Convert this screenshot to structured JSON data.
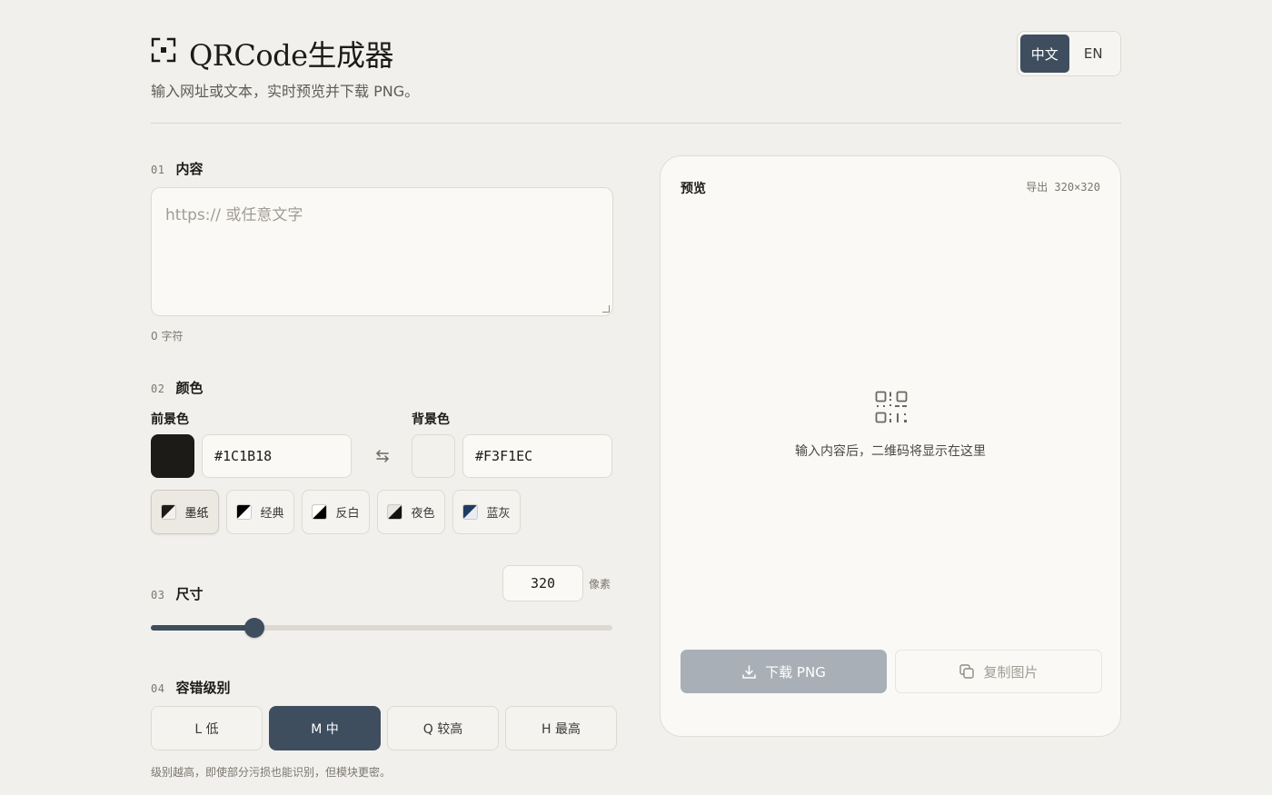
{
  "header": {
    "logo_icon": "qr-scan-icon",
    "title": "QRCode生成器",
    "subtitle": "输入网址或文本，实时预览并下载 PNG。",
    "lang_options": [
      {
        "label": "中文",
        "active": true
      },
      {
        "label": "EN",
        "active": false
      }
    ]
  },
  "content_section": {
    "num": "01",
    "name": "内容",
    "placeholder": "https:// 或任意文字",
    "value": "",
    "char_count": "0 字符"
  },
  "color_section": {
    "num": "02",
    "name": "颜色",
    "foreground_label": "前景色",
    "foreground_hex": "#1C1B18",
    "background_label": "背景色",
    "background_hex": "#F3F1EC",
    "swap_icon": "swap-arrows-icon",
    "presets": [
      {
        "label": "墨纸",
        "fg": "#1c1b18",
        "bg": "#f3f1ec",
        "active": true
      },
      {
        "label": "经典",
        "fg": "#000000",
        "bg": "#ffffff",
        "active": false
      },
      {
        "label": "反白",
        "fg": "#ffffff",
        "bg": "#000000",
        "active": false
      },
      {
        "label": "夜色",
        "fg": "#e8e6e0",
        "bg": "#121212",
        "active": false
      },
      {
        "label": "蓝灰",
        "fg": "#1f3b63",
        "bg": "#e9edf3",
        "active": false
      }
    ]
  },
  "size_section": {
    "num": "03",
    "name": "尺寸",
    "value": "320",
    "unit": "像素",
    "slider_fraction": 0.225
  },
  "ec_section": {
    "num": "04",
    "name": "容错级别",
    "options": [
      {
        "label": "L 低",
        "active": false
      },
      {
        "label": "M 中",
        "active": true
      },
      {
        "label": "Q 较高",
        "active": false
      },
      {
        "label": "H 最高",
        "active": false
      }
    ],
    "hint": "级别越高，即使部分污损也能识别，但模块更密。"
  },
  "preview": {
    "title": "预览",
    "export_info": "导出 320×320",
    "empty_icon": "qr-code-icon",
    "empty_text": "输入内容后，二维码将显示在这里",
    "download_label": "下载 PNG",
    "download_icon": "download-icon",
    "copy_label": "复制图片",
    "copy_icon": "copy-icon"
  },
  "colors": {
    "accent": "#3e4e5f",
    "background": "#f2f0ec",
    "card": "#faf9f6",
    "disabled_button": "#a8afb6"
  }
}
